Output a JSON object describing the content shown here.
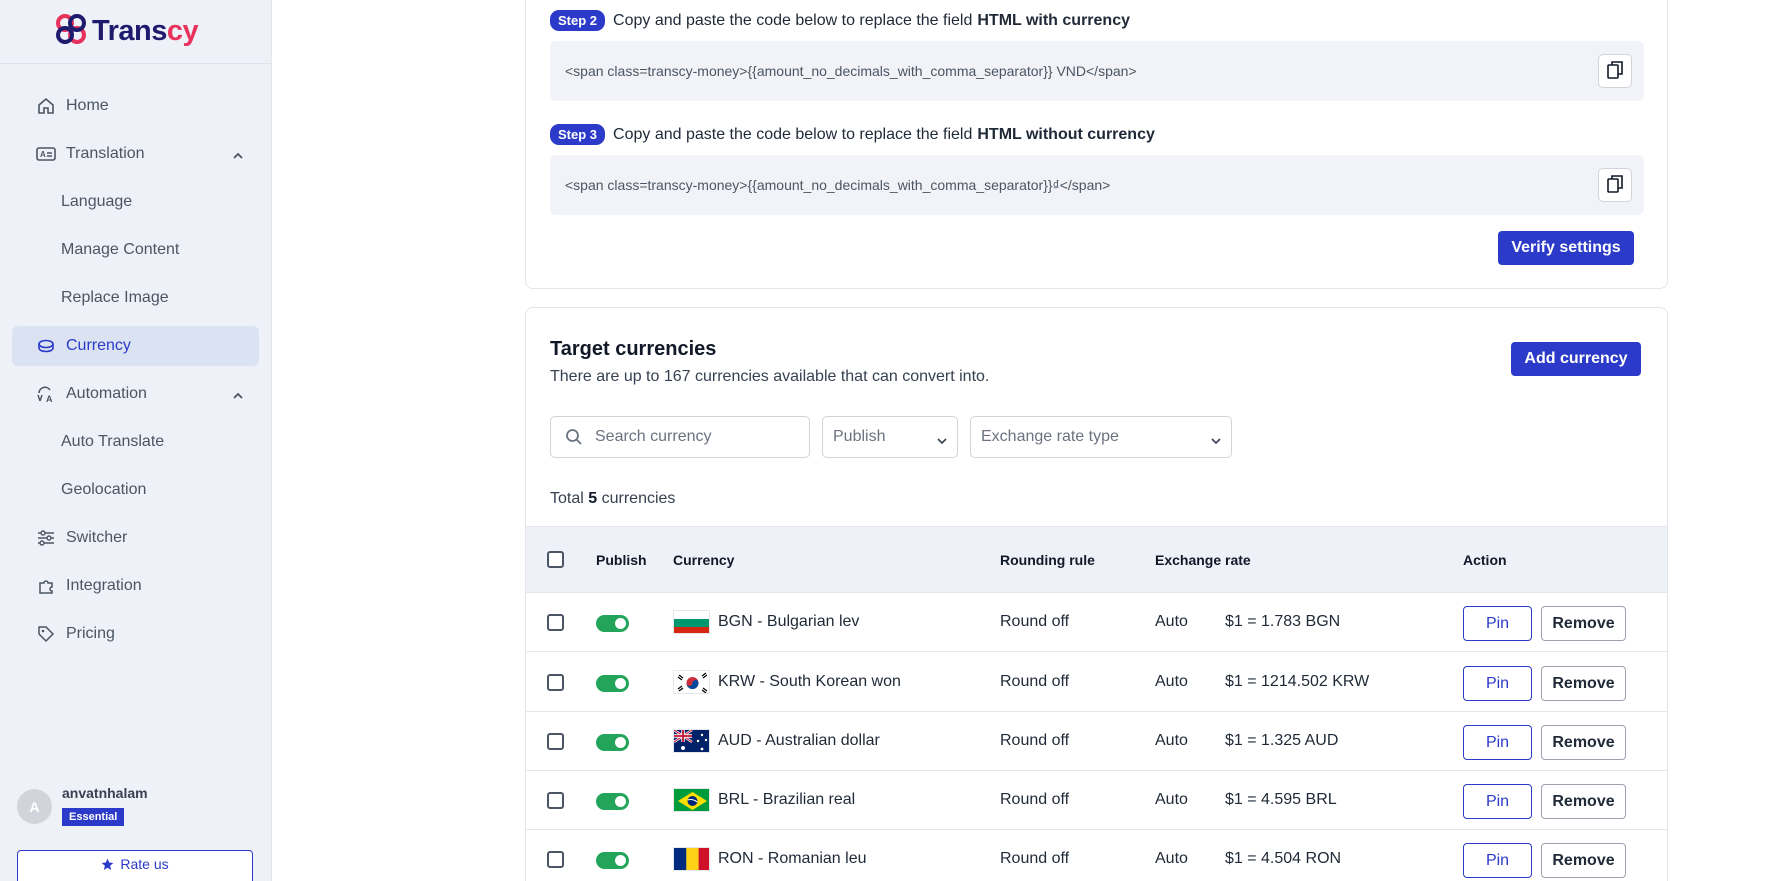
{
  "app": {
    "logo_prefix": "Trans",
    "logo_accent": "cy"
  },
  "sidebar": {
    "items": [
      {
        "label": "Home",
        "icon": "home-icon"
      },
      {
        "label": "Translation",
        "icon": "translation-icon"
      },
      {
        "label": "Language"
      },
      {
        "label": "Manage Content"
      },
      {
        "label": "Replace Image"
      },
      {
        "label": "Currency",
        "icon": "coins-icon",
        "active": true
      },
      {
        "label": "Automation",
        "icon": "auto-translate-icon"
      },
      {
        "label": "Auto Translate"
      },
      {
        "label": "Geolocation"
      },
      {
        "label": "Switcher",
        "icon": "sliders-icon"
      },
      {
        "label": "Integration",
        "icon": "puzzle-icon"
      },
      {
        "label": "Pricing",
        "icon": "tag-icon"
      }
    ],
    "user": {
      "initial": "A",
      "name": "anvatnhalam",
      "plan": "Essential"
    },
    "rate_label": "Rate us"
  },
  "setup": {
    "step2": {
      "badge": "Step 2",
      "text": "Copy and paste the code below to replace the field",
      "field": "HTML with currency",
      "code": "<span class=transcy-money>{{amount_no_decimals_with_comma_separator}} VND</span>"
    },
    "step3": {
      "badge": "Step 3",
      "text": "Copy and paste the code below to replace the field",
      "field": "HTML without currency",
      "code": "<span class=transcy-money>{{amount_no_decimals_with_comma_separator}}₫</span>"
    },
    "verify_label": "Verify settings"
  },
  "targets": {
    "title": "Target currencies",
    "description": "There are up to 167 currencies available that can convert into.",
    "add_label": "Add currency",
    "search_placeholder": "Search currency",
    "publish_filter": "Publish",
    "rate_type_filter": "Exchange rate type",
    "total_prefix": "Total",
    "total_count": "5",
    "total_suffix": "currencies",
    "columns": [
      "Publish",
      "Currency",
      "Rounding rule",
      "Exchange rate",
      "Action"
    ],
    "rows": [
      {
        "currency": "BGN - Bulgarian lev",
        "flag": "bulgaria",
        "rounding": "Round off",
        "rate_type": "Auto",
        "rate": "$1 = 1.783 BGN",
        "published": true
      },
      {
        "currency": "KRW - South Korean won",
        "flag": "south-korea",
        "rounding": "Round off",
        "rate_type": "Auto",
        "rate": "$1 = 1214.502 KRW",
        "published": true
      },
      {
        "currency": "AUD - Australian dollar",
        "flag": "australia",
        "rounding": "Round off",
        "rate_type": "Auto",
        "rate": "$1 = 1.325 AUD",
        "published": true
      },
      {
        "currency": "BRL - Brazilian real",
        "flag": "brazil",
        "rounding": "Round off",
        "rate_type": "Auto",
        "rate": "$1 = 4.595 BRL",
        "published": true
      },
      {
        "currency": "RON - Romanian leu",
        "flag": "romania",
        "rounding": "Round off",
        "rate_type": "Auto",
        "rate": "$1 = 4.504 RON",
        "published": true
      }
    ],
    "pin_label": "Pin",
    "remove_label": "Remove"
  },
  "colors": {
    "accent": "#2b3ac8",
    "brand_red": "#e8315b",
    "toggle_on": "#22a55a",
    "sidebar_bg": "#eef1f8"
  }
}
